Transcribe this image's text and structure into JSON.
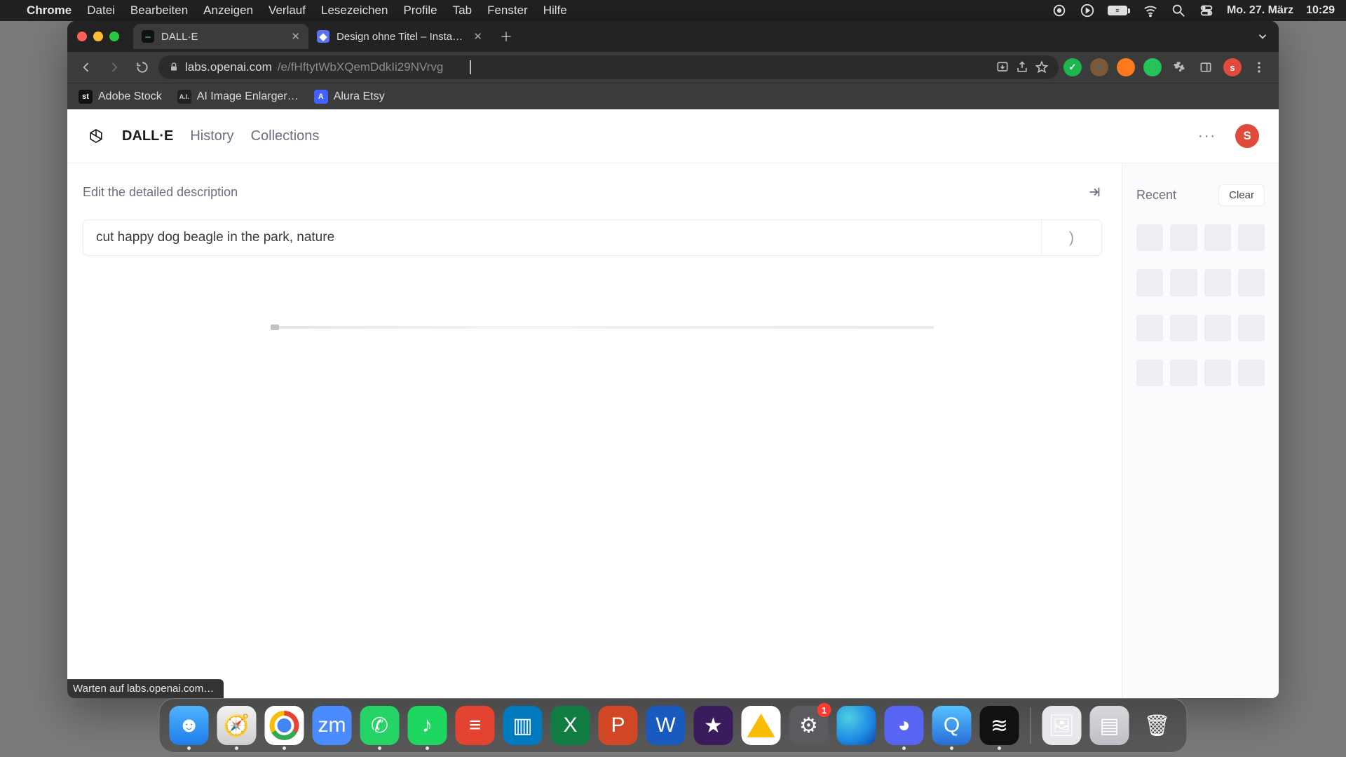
{
  "menubar": {
    "app_name": "Chrome",
    "items": [
      "Datei",
      "Bearbeiten",
      "Anzeigen",
      "Verlauf",
      "Lesezeichen",
      "Profile",
      "Tab",
      "Fenster",
      "Hilfe"
    ],
    "date": "Mo. 27. März",
    "time": "10:29",
    "battery_text": "≡"
  },
  "chrome": {
    "tabs": [
      {
        "title": "DALL·E",
        "favicon_color": "#111",
        "favicon_text": "⎯",
        "active": true
      },
      {
        "title": "Design ohne Titel – Instagram-…",
        "favicon_color": "#5b73f0",
        "favicon_text": "◆",
        "active": false
      }
    ],
    "url_host": "labs.openai.com",
    "url_path": "/e/fHftytWbXQemDdkIi29NVrvg",
    "bookmarks": [
      {
        "label": "Adobe Stock",
        "fav_bg": "#111",
        "fav_text": "st",
        "fav_color": "#fff"
      },
      {
        "label": "AI Image Enlarger…",
        "fav_bg": "#222",
        "fav_text": "AI",
        "fav_color": "#ddd"
      },
      {
        "label": "Alura Etsy",
        "fav_bg": "#4262ff",
        "fav_text": "A",
        "fav_color": "#fff"
      }
    ],
    "profile_letter": "s",
    "profile_bg": "#e24a3b",
    "loading_status": "Warten auf labs.openai.com…"
  },
  "dalle": {
    "nav": {
      "brand": "DALL·E",
      "history": "History",
      "collections": "Collections"
    },
    "edit_label": "Edit the detailed description",
    "prompt_value": "cut happy dog beagle in the park, nature",
    "prompt_suffix": ")",
    "side": {
      "title": "Recent",
      "clear": "Clear",
      "placeholder_rows": 4
    },
    "avatar_letter": "S",
    "more": "···"
  },
  "dock": {
    "apps_main": [
      {
        "name": "finder",
        "cls": "d-finder",
        "glyph": "☻",
        "running": true
      },
      {
        "name": "safari",
        "cls": "d-safari",
        "glyph": "🧭",
        "running": true
      },
      {
        "name": "chrome",
        "cls": "d-chrome",
        "glyph": "",
        "running": true,
        "chrome": true
      },
      {
        "name": "zoom",
        "cls": "d-zoom",
        "glyph": "zm",
        "running": false
      },
      {
        "name": "whatsapp",
        "cls": "d-whatsapp",
        "glyph": "✆",
        "running": true
      },
      {
        "name": "spotify",
        "cls": "d-spotify",
        "glyph": "♪",
        "running": true
      },
      {
        "name": "todoist",
        "cls": "d-todoist",
        "glyph": "≡",
        "running": false
      },
      {
        "name": "trello",
        "cls": "d-trello",
        "glyph": "▥",
        "running": false
      },
      {
        "name": "excel",
        "cls": "d-excel",
        "glyph": "X",
        "running": false
      },
      {
        "name": "powerpoint",
        "cls": "d-ppt",
        "glyph": "P",
        "running": false
      },
      {
        "name": "word",
        "cls": "d-word",
        "glyph": "W",
        "running": false
      },
      {
        "name": "imovie",
        "cls": "d-imovie",
        "glyph": "★",
        "running": false
      },
      {
        "name": "drive",
        "cls": "d-drive",
        "glyph": "",
        "running": false,
        "drive": true
      },
      {
        "name": "settings",
        "cls": "d-settings",
        "glyph": "⚙",
        "running": false,
        "badge": "1"
      },
      {
        "name": "siri",
        "cls": "d-siri",
        "glyph": "",
        "running": false
      },
      {
        "name": "discord",
        "cls": "d-discord",
        "glyph": "◕",
        "running": true
      },
      {
        "name": "quicktime",
        "cls": "d-qt",
        "glyph": "Q",
        "running": true
      },
      {
        "name": "voice-memos",
        "cls": "d-voice",
        "glyph": "≋",
        "running": true
      }
    ],
    "apps_right": [
      {
        "name": "preview",
        "cls": "d-preview",
        "glyph": "🖼"
      },
      {
        "name": "downloads",
        "cls": "d-folder",
        "glyph": "▤"
      },
      {
        "name": "trash",
        "cls": "d-trash",
        "glyph": "🗑"
      }
    ]
  }
}
